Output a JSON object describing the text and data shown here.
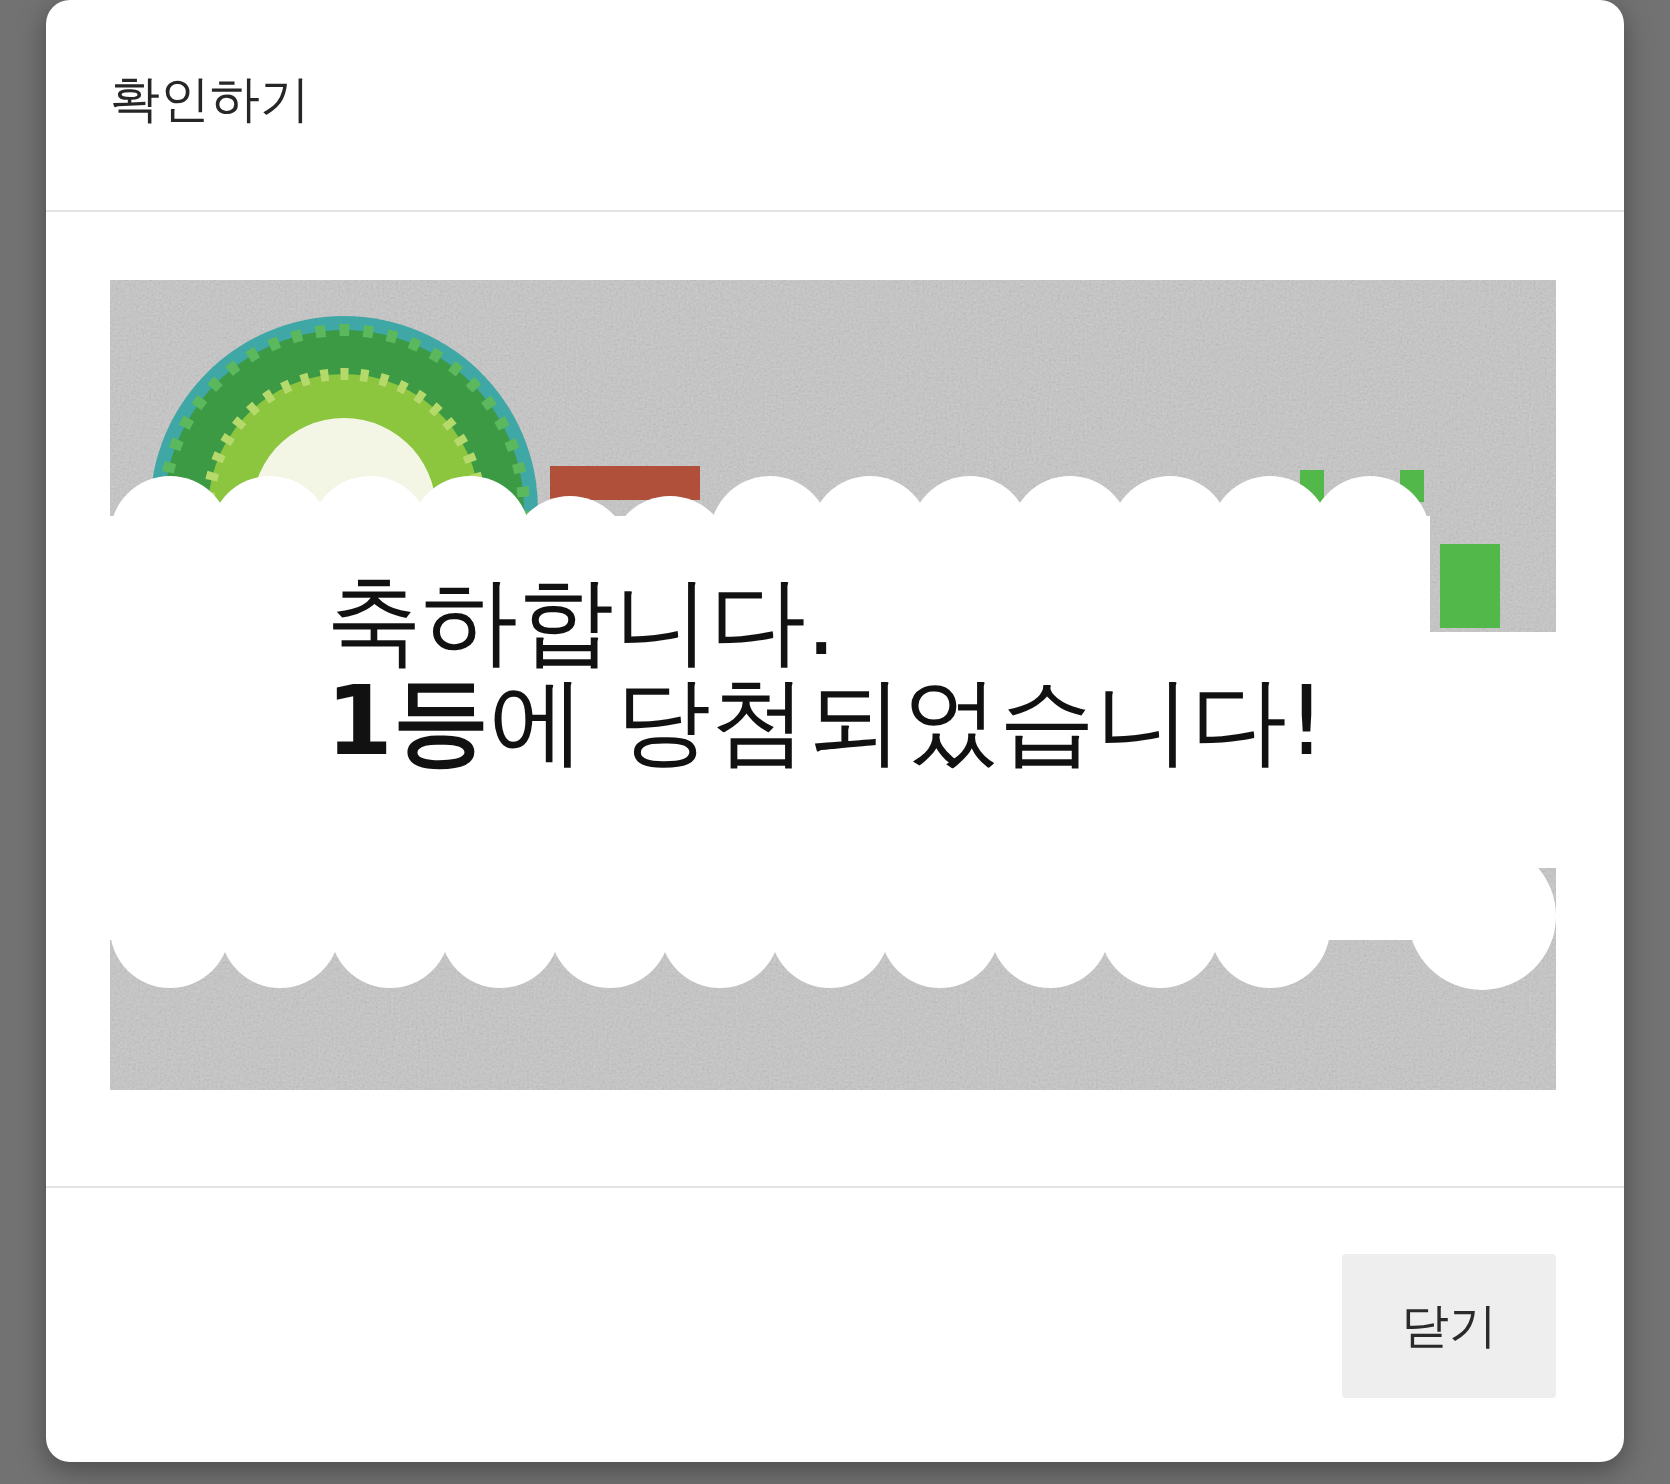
{
  "dialog": {
    "title": "확인하기"
  },
  "scratch_card": {
    "message": [
      "축하합니다.",
      "**1등**에 당첨되었습니다!"
    ]
  },
  "buttons": [
    {
      "label": "닫기"
    }
  ]
}
